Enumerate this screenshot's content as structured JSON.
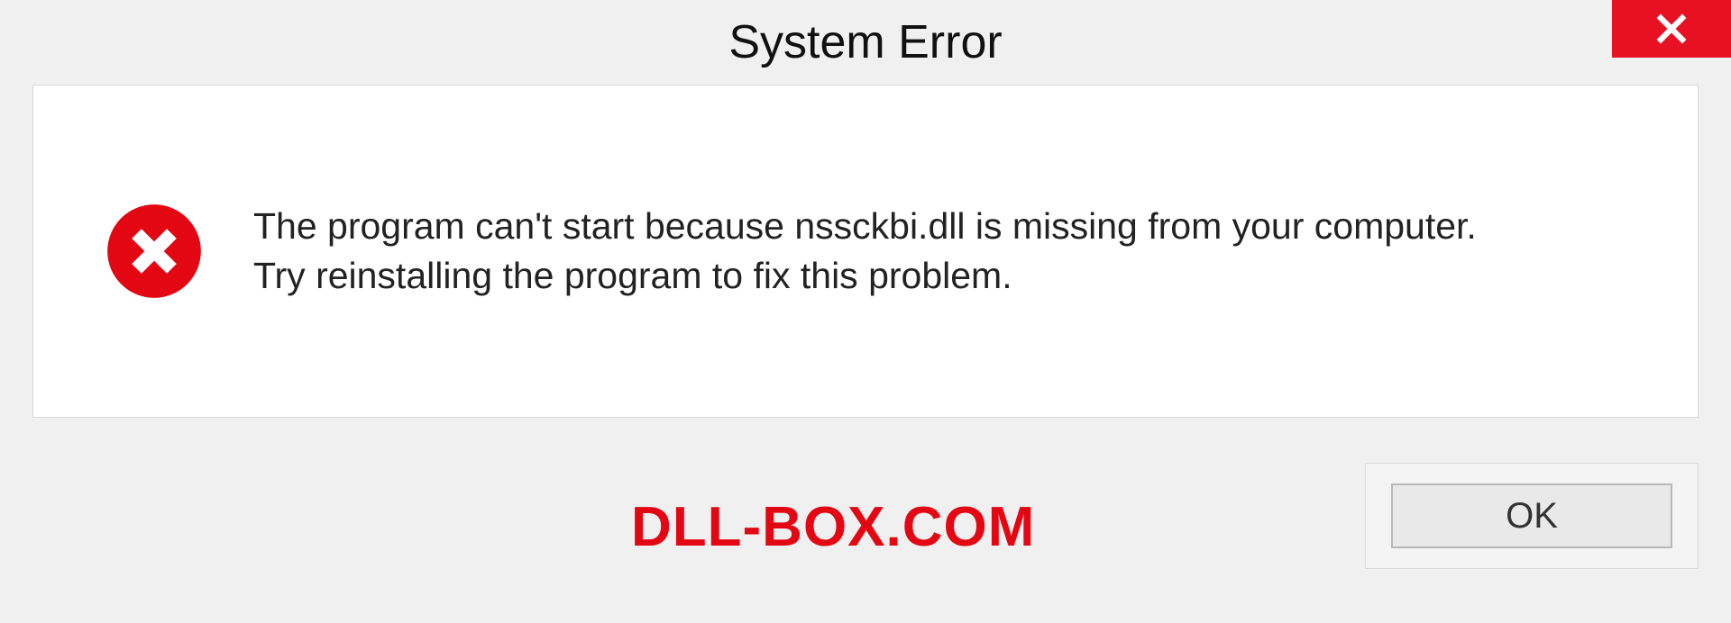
{
  "titlebar": {
    "title": "System Error"
  },
  "message": {
    "line1": "The program can't start because nssckbi.dll is missing from your computer.",
    "line2": "Try reinstalling the program to fix this problem."
  },
  "footer": {
    "ok_label": "OK",
    "watermark": "DLL-BOX.COM"
  },
  "colors": {
    "close_red": "#e81123",
    "error_red": "#e30613",
    "watermark_red": "#e30613"
  }
}
